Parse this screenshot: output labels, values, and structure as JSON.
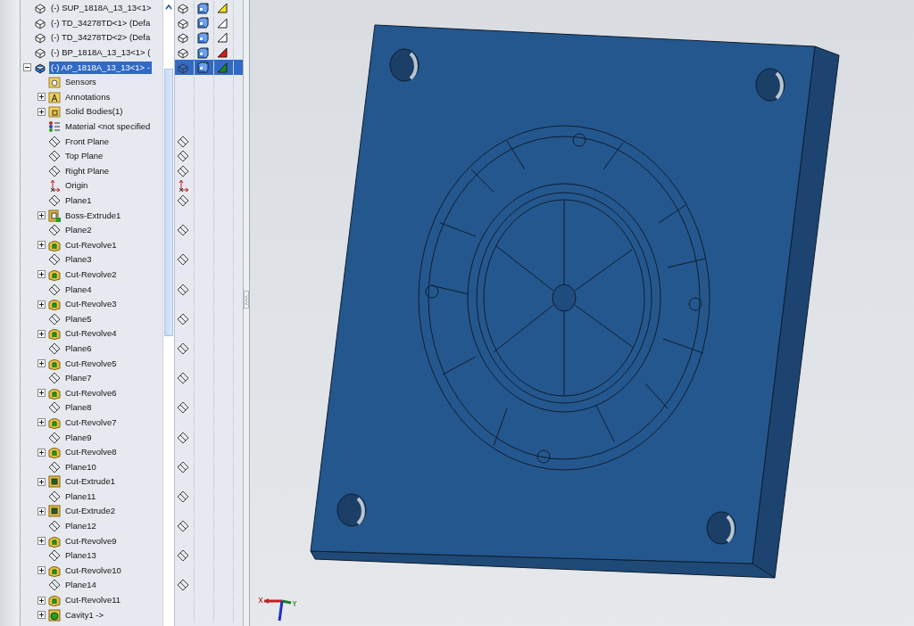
{
  "tree": {
    "items": [
      {
        "kind": "component",
        "label": "(-) SUP_1818A_13_13<1>",
        "selected": false,
        "color": "#f2e21a"
      },
      {
        "kind": "component",
        "label": "(-) TD_34278TD<1> (Defa",
        "selected": false,
        "color": "#ffffff"
      },
      {
        "kind": "component",
        "label": "(-) TD_34278TD<2> (Defa",
        "selected": false,
        "color": "#ffffff"
      },
      {
        "kind": "component",
        "label": "(-) BP_1818A_13_13<1> (",
        "selected": false,
        "color": "#e01818"
      },
      {
        "kind": "component",
        "label": "(-) AP_1818A_13_13<1> -",
        "selected": true,
        "color": "#1a8a1a",
        "expanded": true,
        "children": [
          {
            "kind": "sensors",
            "label": "Sensors",
            "selected": false
          },
          {
            "kind": "annotations",
            "label": "Annotations",
            "selected": false,
            "expanded": false
          },
          {
            "kind": "bodies",
            "label": "Solid Bodies(1)",
            "selected": false,
            "expanded": false
          },
          {
            "kind": "material",
            "label": "Material <not specified",
            "selected": false
          },
          {
            "kind": "plane",
            "label": "Front Plane",
            "selected": false
          },
          {
            "kind": "plane",
            "label": "Top Plane",
            "selected": false
          },
          {
            "kind": "plane",
            "label": "Right Plane",
            "selected": false
          },
          {
            "kind": "origin",
            "label": "Origin",
            "selected": false
          },
          {
            "kind": "plane",
            "label": "Plane1",
            "selected": false
          },
          {
            "kind": "boss",
            "label": "Boss-Extrude1",
            "selected": false,
            "expanded": false
          },
          {
            "kind": "plane",
            "label": "Plane2",
            "selected": false
          },
          {
            "kind": "revolve",
            "label": "Cut-Revolve1",
            "selected": false,
            "expanded": false
          },
          {
            "kind": "plane",
            "label": "Plane3",
            "selected": false
          },
          {
            "kind": "revolve",
            "label": "Cut-Revolve2",
            "selected": false,
            "expanded": false
          },
          {
            "kind": "plane",
            "label": "Plane4",
            "selected": false
          },
          {
            "kind": "revolve",
            "label": "Cut-Revolve3",
            "selected": false,
            "expanded": false
          },
          {
            "kind": "plane",
            "label": "Plane5",
            "selected": false
          },
          {
            "kind": "revolve",
            "label": "Cut-Revolve4",
            "selected": false,
            "expanded": false
          },
          {
            "kind": "plane",
            "label": "Plane6",
            "selected": false
          },
          {
            "kind": "revolve",
            "label": "Cut-Revolve5",
            "selected": false,
            "expanded": false
          },
          {
            "kind": "plane",
            "label": "Plane7",
            "selected": false
          },
          {
            "kind": "revolve",
            "label": "Cut-Revolve6",
            "selected": false,
            "expanded": false
          },
          {
            "kind": "plane",
            "label": "Plane8",
            "selected": false
          },
          {
            "kind": "revolve",
            "label": "Cut-Revolve7",
            "selected": false,
            "expanded": false
          },
          {
            "kind": "plane",
            "label": "Plane9",
            "selected": false
          },
          {
            "kind": "revolve",
            "label": "Cut-Revolve8",
            "selected": false,
            "expanded": false
          },
          {
            "kind": "plane",
            "label": "Plane10",
            "selected": false
          },
          {
            "kind": "extrude",
            "label": "Cut-Extrude1",
            "selected": false,
            "expanded": false
          },
          {
            "kind": "plane",
            "label": "Plane11",
            "selected": false
          },
          {
            "kind": "extrude",
            "label": "Cut-Extrude2",
            "selected": false,
            "expanded": false
          },
          {
            "kind": "plane",
            "label": "Plane12",
            "selected": false
          },
          {
            "kind": "revolve",
            "label": "Cut-Revolve9",
            "selected": false,
            "expanded": false
          },
          {
            "kind": "plane",
            "label": "Plane13",
            "selected": false
          },
          {
            "kind": "revolve",
            "label": "Cut-Revolve10",
            "selected": false,
            "expanded": false
          },
          {
            "kind": "plane",
            "label": "Plane14",
            "selected": false
          },
          {
            "kind": "revolve",
            "label": "Cut-Revolve11",
            "selected": false,
            "expanded": false
          },
          {
            "kind": "cavity",
            "label": "Cavity1 ->",
            "selected": false,
            "expanded": false
          }
        ]
      }
    ]
  }
}
